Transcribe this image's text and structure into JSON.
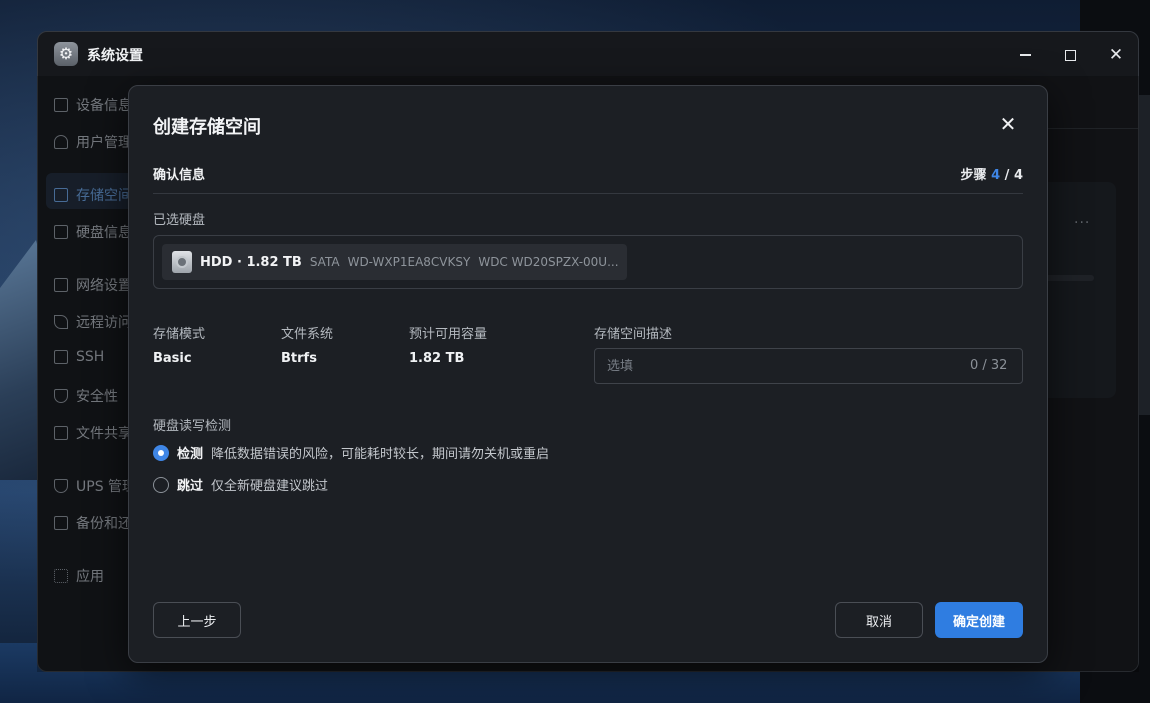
{
  "window": {
    "title": "系统设置",
    "app_icon": "gear-icon"
  },
  "sidebar": {
    "items": [
      {
        "label": "设备信息",
        "icon": "device-icon"
      },
      {
        "label": "用户管理",
        "icon": "user-icon"
      },
      {
        "label": "存储空间",
        "icon": "storage-icon",
        "active": true
      },
      {
        "label": "硬盘信息",
        "icon": "disk-icon"
      },
      {
        "label": "网络设置",
        "icon": "network-icon"
      },
      {
        "label": "远程访问",
        "icon": "send-icon"
      },
      {
        "label": "SSH",
        "icon": "code-icon"
      },
      {
        "label": "安全性",
        "icon": "shield-icon"
      },
      {
        "label": "文件共享",
        "icon": "file-icon"
      },
      {
        "label": "UPS 管理",
        "icon": "ups-icon"
      },
      {
        "label": "备份和还原",
        "icon": "backup-icon"
      },
      {
        "label": "应用",
        "icon": "apps-icon"
      }
    ]
  },
  "dialog": {
    "title": "创建存储空间",
    "section": "确认信息",
    "step_label": "步骤",
    "step_current": "4",
    "step_sep": "/",
    "step_total": "4",
    "selected_disks_label": "已选硬盘",
    "disk": {
      "name": "HDD · 1.82 TB",
      "interface": "SATA",
      "serial": "WD-WXP1EA8CVKSY",
      "model": "WDC WD20SPZX-00U..."
    },
    "storage_mode_label": "存储模式",
    "storage_mode_value": "Basic",
    "filesystem_label": "文件系统",
    "filesystem_value": "Btrfs",
    "capacity_label": "预计可用容量",
    "capacity_value": "1.82 TB",
    "description_label": "存储空间描述",
    "description_placeholder": "选填",
    "description_value": "",
    "description_count": "0 / 32",
    "check_label": "硬盘读写检测",
    "options": [
      {
        "label": "检测",
        "desc": "降低数据错误的风险，可能耗时较长，期间请勿关机或重启",
        "selected": true
      },
      {
        "label": "跳过",
        "desc": "仅全新硬盘建议跳过",
        "selected": false
      }
    ],
    "prev_button": "上一步",
    "cancel_button": "取消",
    "confirm_button": "确定创建"
  },
  "colors": {
    "accent": "#2f7de1",
    "dialog_bg": "#1c1f24",
    "window_bg": "#16181c"
  }
}
